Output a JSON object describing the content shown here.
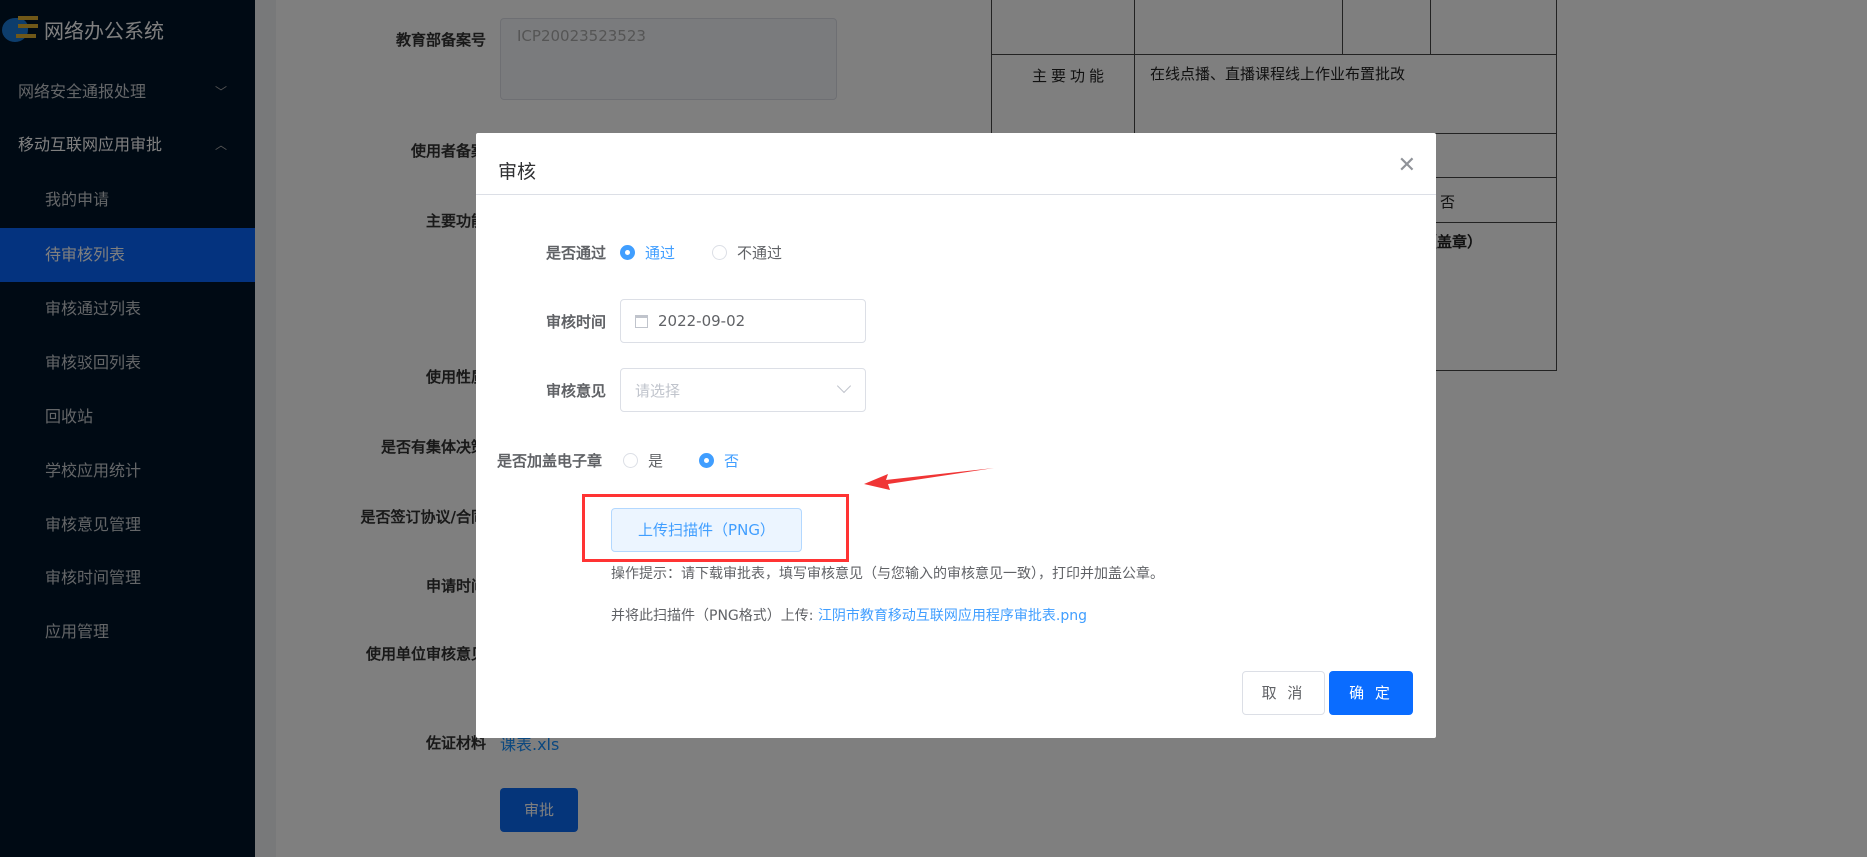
{
  "app": {
    "title": "网络办公系统"
  },
  "sidebar": {
    "groups": [
      {
        "label": "网络安全通报处理",
        "expanded": false
      },
      {
        "label": "移动互联网应用审批",
        "expanded": true
      }
    ],
    "items": [
      "我的申请",
      "待审核列表",
      "审核通过列表",
      "审核驳回列表",
      "回收站",
      "学校应用统计",
      "审核意见管理",
      "审核时间管理",
      "应用管理"
    ],
    "active": "待审核列表"
  },
  "background_form": {
    "labels": [
      "教育部备案号",
      "使用者备案",
      "主要功能",
      "使用性质",
      "是否有集体决策",
      "是否签订协议/合同",
      "申请时间",
      "使用单位审核意见",
      "佐证材料"
    ],
    "icp_value": "ICP20023523523",
    "attachment": "课表.xls",
    "approve_button": "审批"
  },
  "document": {
    "main_function_label": "主要功能",
    "main_function_value": "在线点播、直播课程线上作业布置批改",
    "no_cell": "否",
    "seal": "（盖章）"
  },
  "dialog": {
    "title": "审核",
    "pass_label": "是否通过",
    "pass_options": [
      "通过",
      "不通过"
    ],
    "pass_selected": "通过",
    "time_label": "审核时间",
    "time_value": "2022-09-02",
    "opinion_label": "审核意见",
    "opinion_placeholder": "请选择",
    "seal_label": "是否加盖电子章",
    "seal_options": [
      "是",
      "否"
    ],
    "seal_selected": "否",
    "upload_button": "上传扫描件（PNG）",
    "hint1": "操作提示：请下载审批表，填写审核意见（与您输入的审核意见一致），打印并加盖公章。",
    "hint2_prefix": "并将此扫描件（PNG格式）上传: ",
    "hint2_link": "江阴市教育移动互联网应用程序审批表.png",
    "cancel": "取 消",
    "ok": "确 定"
  },
  "colors": {
    "primary": "#409eff",
    "annotation": "#ff3333"
  }
}
